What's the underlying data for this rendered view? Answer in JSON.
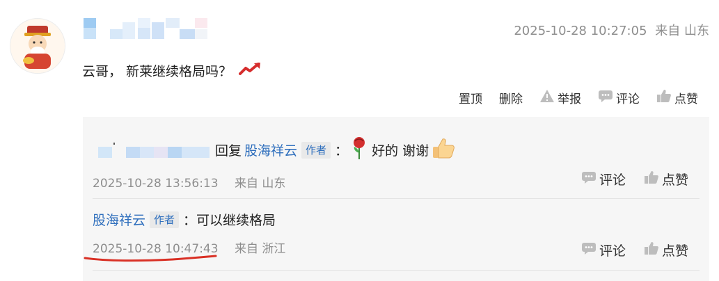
{
  "post": {
    "timestamp": "2025-10-28 10:27:05",
    "location": "来自 山东",
    "text": "云哥， 新莱继续格局吗？"
  },
  "actions": {
    "pin": "置顶",
    "delete": "删除",
    "report": "举报",
    "comment": "评论",
    "like": "点赞"
  },
  "replies": [
    {
      "reply_word": "回复",
      "to_user": "股海祥云",
      "tag": "作者",
      "separator": "：",
      "text": "好的 谢谢",
      "timestamp": "2025-10-28 13:56:13",
      "location": "来自 山东",
      "comment": "评论",
      "like": "点赞"
    },
    {
      "user": "股海祥云",
      "tag": "作者",
      "text": "：可以继续格局",
      "timestamp": "2025-10-28 10:47:43",
      "location": "来自 浙江",
      "comment": "评论",
      "like": "点赞"
    }
  ],
  "colors": {
    "link": "#2f6fbd",
    "meta": "#8e8e8e",
    "highlight": "#d93025"
  }
}
